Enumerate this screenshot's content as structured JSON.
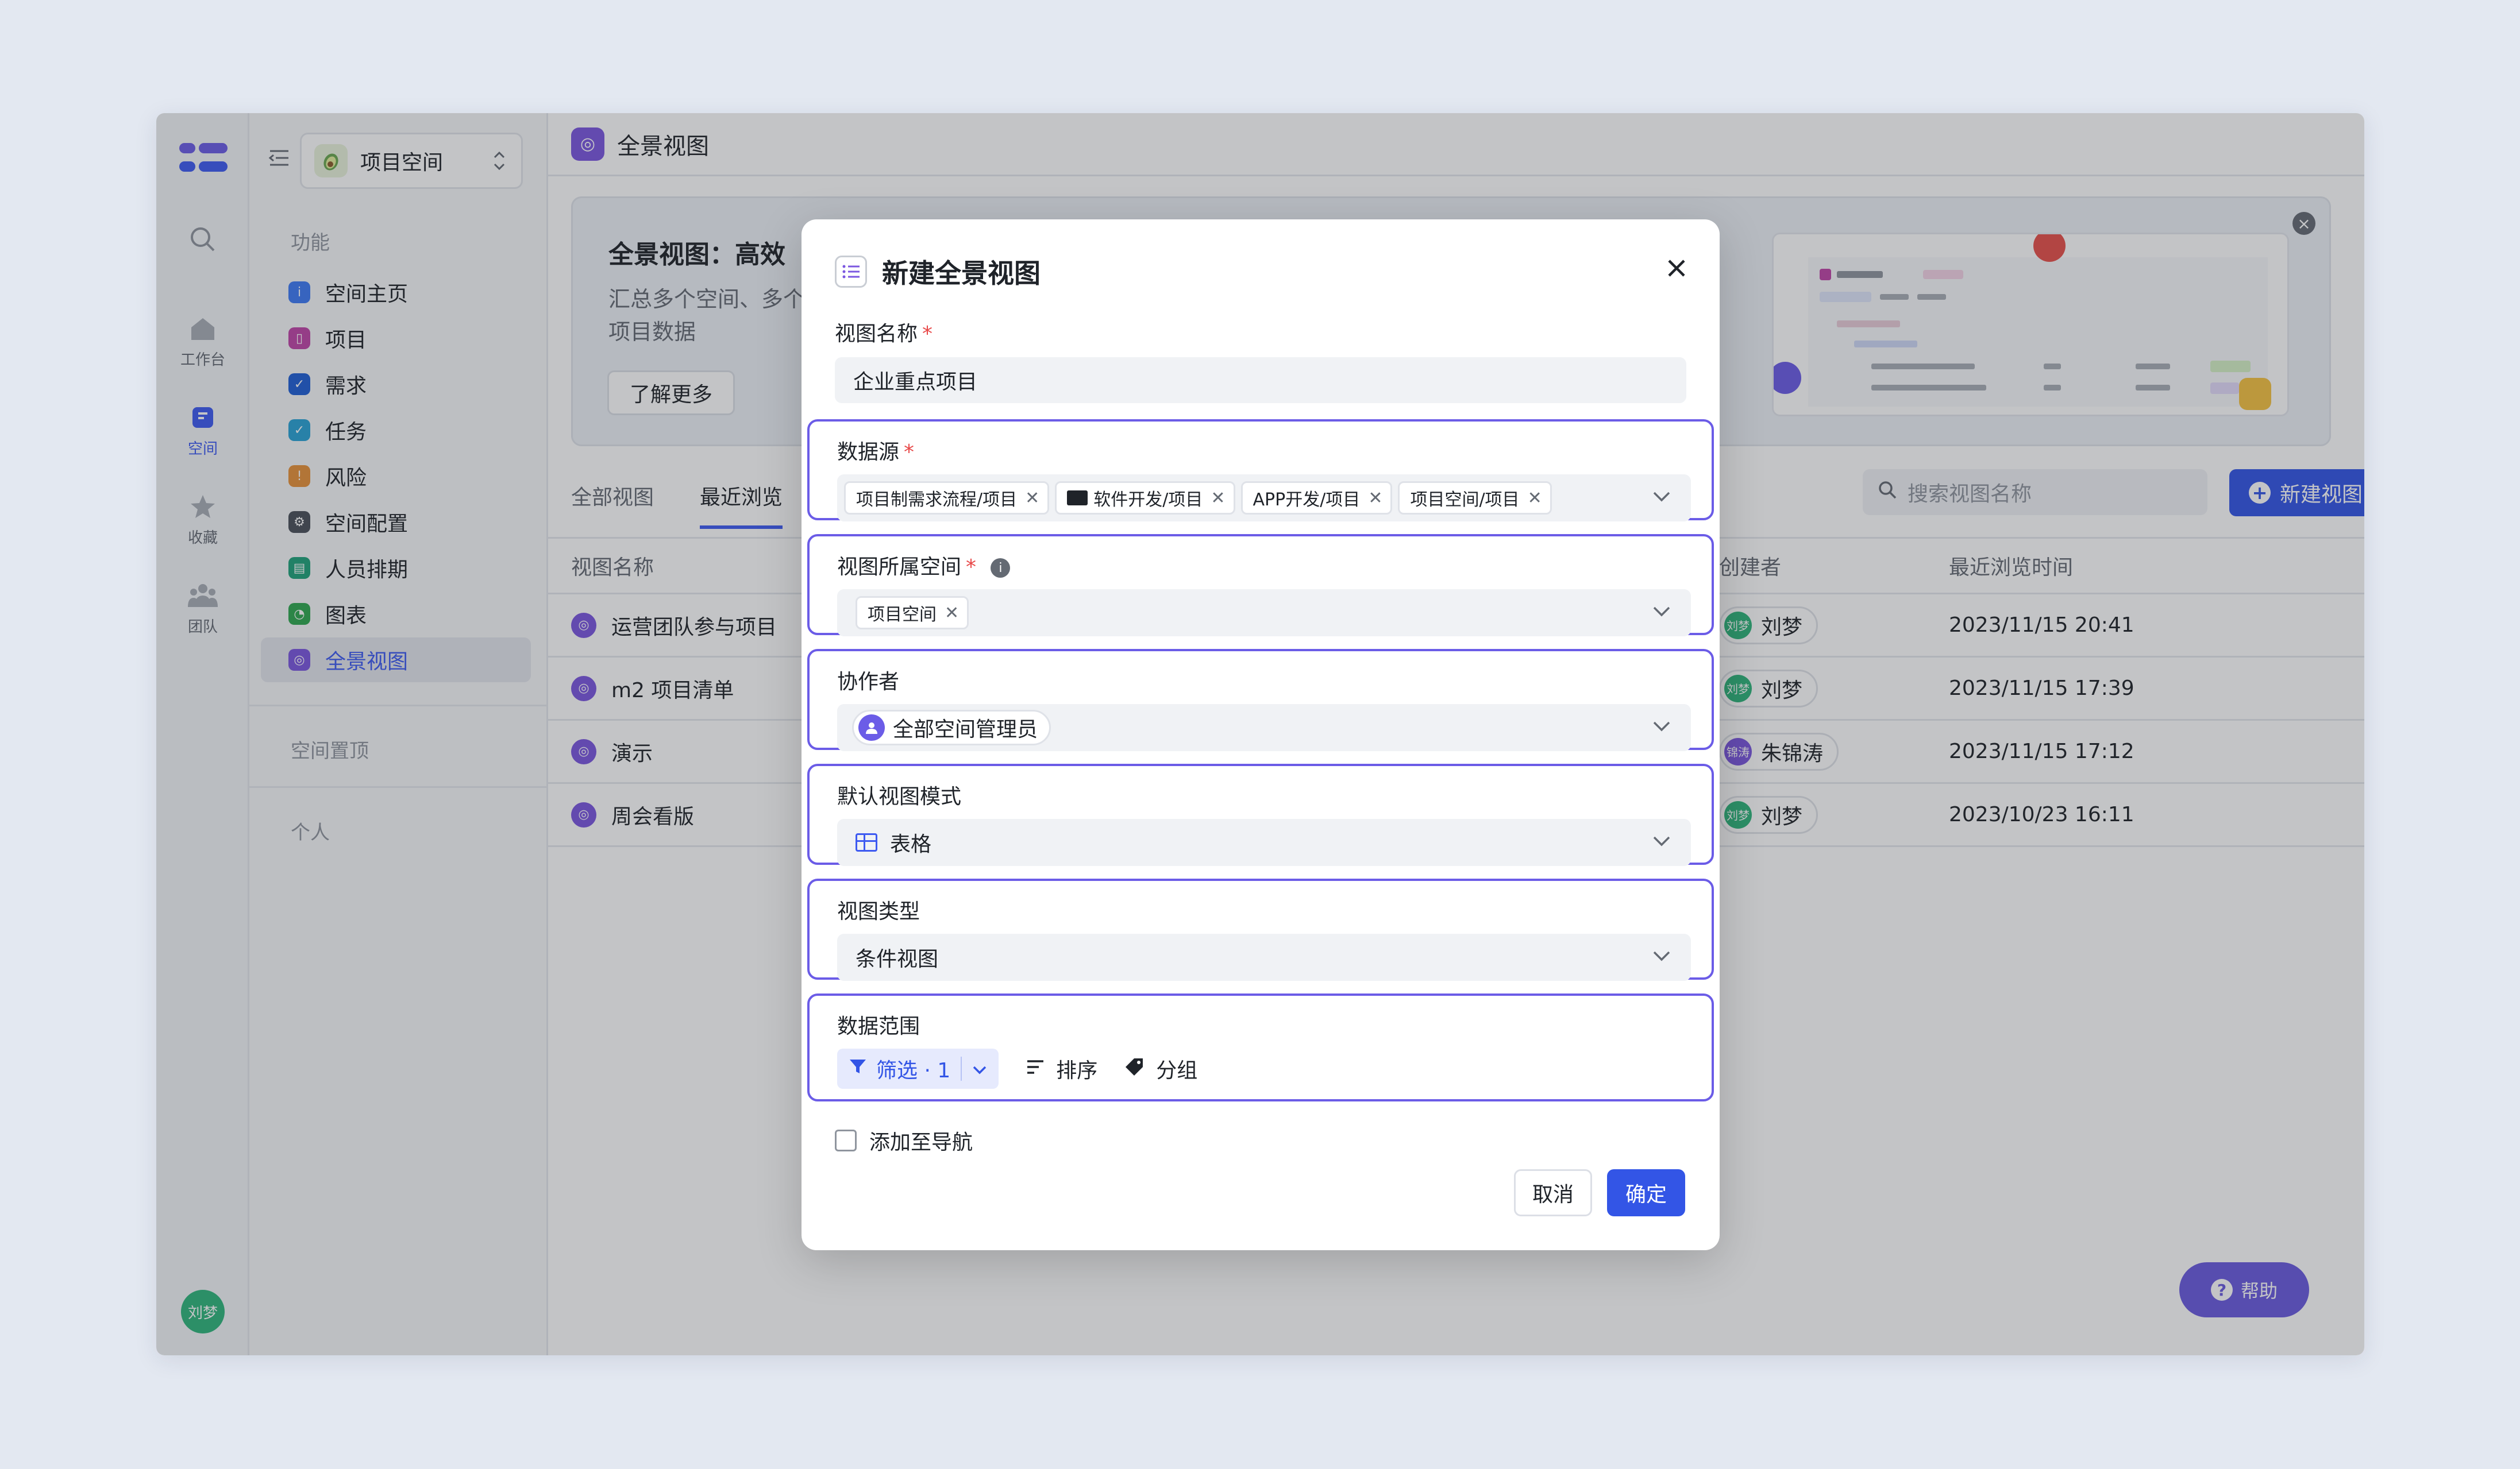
{
  "rail": {
    "items": [
      {
        "label": "工作台",
        "icon": "home-icon"
      },
      {
        "label": "空间",
        "icon": "space-icon"
      },
      {
        "label": "收藏",
        "icon": "star-icon"
      },
      {
        "label": "团队",
        "icon": "team-icon"
      }
    ],
    "avatar": "刘梦"
  },
  "sidebar": {
    "space_name": "项目空间",
    "group_function": "功能",
    "items": [
      {
        "label": "空间主页",
        "color": "#3d7bf5"
      },
      {
        "label": "项目",
        "color": "#c045a8"
      },
      {
        "label": "需求",
        "color": "#1f5fd6"
      },
      {
        "label": "任务",
        "color": "#29a3d6"
      },
      {
        "label": "风险",
        "color": "#e8923a"
      },
      {
        "label": "空间配置",
        "color": "#4a4f59"
      },
      {
        "label": "人员排期",
        "color": "#1fa37a"
      },
      {
        "label": "图表",
        "color": "#2fa84f"
      },
      {
        "label": "全景视图",
        "color": "#7b57e0"
      }
    ],
    "group_pinned": "空间置顶",
    "group_personal": "个人"
  },
  "main": {
    "title": "全景视图",
    "banner": {
      "title": "全景视图：高效",
      "desc": "汇总多个空间、多个项目数据",
      "learn_more": "了解更多"
    },
    "tabs": [
      "全部视图",
      "最近浏览"
    ],
    "search_placeholder": "搜索视图名称",
    "new_view": "新建视图",
    "table": {
      "headers": [
        "视图名称",
        "创建者",
        "最近浏览时间"
      ],
      "rows": [
        {
          "name": "运营团队参与项目",
          "creator": "刘梦",
          "avatar": "刘梦",
          "time": "2023/11/15 20:41"
        },
        {
          "name": "m2 项目清单",
          "creator": "刘梦",
          "avatar": "刘梦",
          "time": "2023/11/15 17:39"
        },
        {
          "name": "演示",
          "creator": "朱锦涛",
          "avatar": "锦涛",
          "time": "2023/11/15 17:12"
        },
        {
          "name": "周会看版",
          "creator": "刘梦",
          "avatar": "刘梦",
          "time": "2023/10/23 16:11"
        }
      ]
    },
    "help": "帮助"
  },
  "modal": {
    "title": "新建全景视图",
    "view_name": {
      "label": "视图名称",
      "value": "企业重点项目"
    },
    "data_source": {
      "label": "数据源",
      "tags": [
        "项目制需求流程/项目",
        "软件开发/项目",
        "APP开发/项目",
        "项目空间/项目"
      ]
    },
    "space": {
      "label": "视图所属空间",
      "tags": [
        "项目空间"
      ]
    },
    "collaborator": {
      "label": "协作者",
      "value": "全部空间管理员"
    },
    "default_mode": {
      "label": "默认视图模式",
      "value": "表格"
    },
    "view_type": {
      "label": "视图类型",
      "value": "条件视图"
    },
    "data_range": {
      "label": "数据范围",
      "filter": "筛选 · 1",
      "sort": "排序",
      "group": "分组"
    },
    "add_nav": "添加至导航",
    "cancel": "取消",
    "confirm": "确定"
  }
}
